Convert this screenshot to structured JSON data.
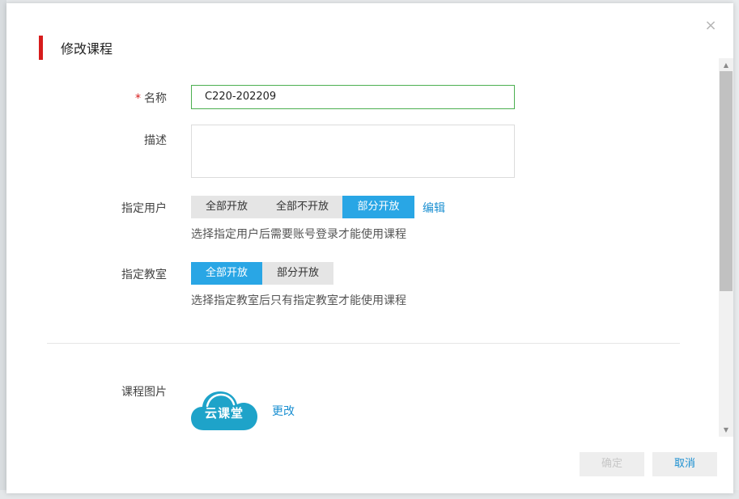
{
  "dialog": {
    "title": "修改课程",
    "close_glyph": "×"
  },
  "form": {
    "name": {
      "required_mark": "*",
      "label": "名称",
      "value": "C220-202209"
    },
    "description": {
      "label": "描述",
      "value": ""
    },
    "assign_users": {
      "label": "指定用户",
      "options": [
        "全部开放",
        "全部不开放",
        "部分开放"
      ],
      "selected": "部分开放",
      "edit_link": "编辑",
      "hint": "选择指定用户后需要账号登录才能使用课程"
    },
    "assign_classroom": {
      "label": "指定教室",
      "options": [
        "全部开放",
        "部分开放"
      ],
      "selected": "全部开放",
      "hint": "选择指定教室后只有指定教室才能使用课程"
    },
    "course_image": {
      "label": "课程图片",
      "logo_text": "云课堂",
      "change_link": "更改"
    }
  },
  "footer": {
    "ok_label": "确定",
    "cancel_label": "取消"
  },
  "colors": {
    "accent": "#29a6e5",
    "title_bar": "#d71c1c",
    "link": "#1a8fd1",
    "input_focus_border": "#4caf50"
  },
  "icons": {
    "close": "close-icon",
    "scroll_up": "scroll-up-icon",
    "scroll_down": "scroll-down-icon",
    "logo": "cloud-logo-icon"
  }
}
